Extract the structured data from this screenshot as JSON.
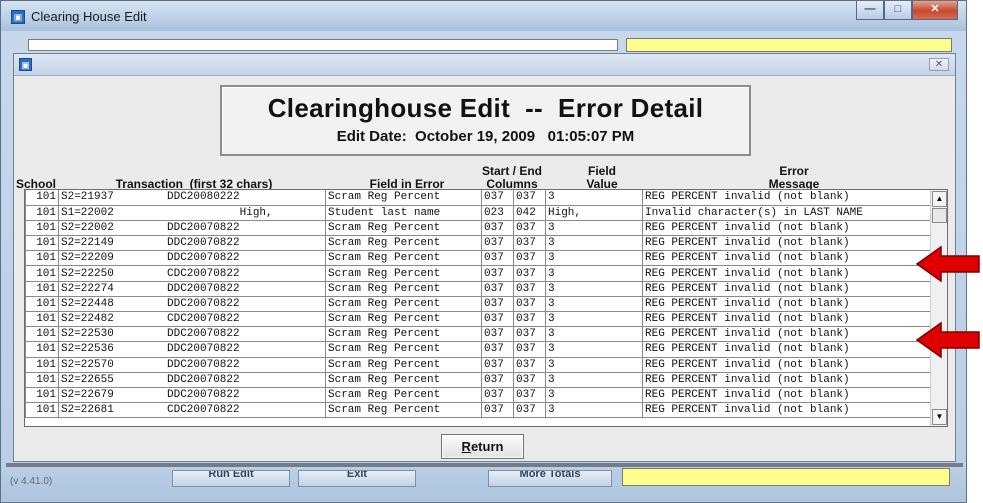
{
  "window": {
    "title": "Clearing House Edit",
    "icon": "app-icon",
    "minimize_icon": "minimize-icon",
    "maximize_icon": "maximize-icon",
    "close_icon": "close-icon"
  },
  "dialog": {
    "title": "Clearinghouse Edit  --  Error Detail",
    "subtitle": "Edit Date:  October 19, 2009   01:05:07 PM",
    "close_icon": "close-icon"
  },
  "columns": {
    "school": "School",
    "transaction": "Transaction  (first 32 chars)",
    "field_in_error": "Field in Error",
    "start_end_1": "Start / End",
    "start_end_2": "Columns",
    "field_value_1": "Field",
    "field_value_2": "Value",
    "error_message_1": "Error",
    "error_message_2": "Message"
  },
  "rows": [
    {
      "school": "101",
      "id": "S2=21937",
      "rest": "DDC20080222",
      "field": "Scram Reg Percent",
      "start": "037",
      "end": "037",
      "value": "3",
      "msg": "REG PERCENT invalid (not blank)"
    },
    {
      "school": "101",
      "id": "S1=22002",
      "rest": "           High,",
      "field": "Student last name",
      "start": "023",
      "end": "042",
      "value": "High,",
      "msg": "Invalid character(s) in LAST NAME"
    },
    {
      "school": "101",
      "id": "S2=22002",
      "rest": "DDC20070822",
      "field": "Scram Reg Percent",
      "start": "037",
      "end": "037",
      "value": "3",
      "msg": "REG PERCENT invalid (not blank)"
    },
    {
      "school": "101",
      "id": "S2=22149",
      "rest": "DDC20070822",
      "field": "Scram Reg Percent",
      "start": "037",
      "end": "037",
      "value": "3",
      "msg": "REG PERCENT invalid (not blank)"
    },
    {
      "school": "101",
      "id": "S2=22209",
      "rest": "DDC20070822",
      "field": "Scram Reg Percent",
      "start": "037",
      "end": "037",
      "value": "3",
      "msg": "REG PERCENT invalid (not blank)"
    },
    {
      "school": "101",
      "id": "S2=22250",
      "rest": "CDC20070822",
      "field": "Scram Reg Percent",
      "start": "037",
      "end": "037",
      "value": "3",
      "msg": "REG PERCENT invalid (not blank)"
    },
    {
      "school": "101",
      "id": "S2=22274",
      "rest": "DDC20070822",
      "field": "Scram Reg Percent",
      "start": "037",
      "end": "037",
      "value": "3",
      "msg": "REG PERCENT invalid (not blank)"
    },
    {
      "school": "101",
      "id": "S2=22448",
      "rest": "DDC20070822",
      "field": "Scram Reg Percent",
      "start": "037",
      "end": "037",
      "value": "3",
      "msg": "REG PERCENT invalid (not blank)"
    },
    {
      "school": "101",
      "id": "S2=22482",
      "rest": "CDC20070822",
      "field": "Scram Reg Percent",
      "start": "037",
      "end": "037",
      "value": "3",
      "msg": "REG PERCENT invalid (not blank)"
    },
    {
      "school": "101",
      "id": "S2=22530",
      "rest": "DDC20070822",
      "field": "Scram Reg Percent",
      "start": "037",
      "end": "037",
      "value": "3",
      "msg": "REG PERCENT invalid (not blank)"
    },
    {
      "school": "101",
      "id": "S2=22536",
      "rest": "DDC20070822",
      "field": "Scram Reg Percent",
      "start": "037",
      "end": "037",
      "value": "3",
      "msg": "REG PERCENT invalid (not blank)"
    },
    {
      "school": "101",
      "id": "S2=22570",
      "rest": "DDC20070822",
      "field": "Scram Reg Percent",
      "start": "037",
      "end": "037",
      "value": "3",
      "msg": "REG PERCENT invalid (not blank)"
    },
    {
      "school": "101",
      "id": "S2=22655",
      "rest": "DDC20070822",
      "field": "Scram Reg Percent",
      "start": "037",
      "end": "037",
      "value": "3",
      "msg": "REG PERCENT invalid (not blank)"
    },
    {
      "school": "101",
      "id": "S2=22679",
      "rest": "DDC20070822",
      "field": "Scram Reg Percent",
      "start": "037",
      "end": "037",
      "value": "3",
      "msg": "REG PERCENT invalid (not blank)"
    },
    {
      "school": "101",
      "id": "S2=22681",
      "rest": "CDC20070822",
      "field": "Scram Reg Percent",
      "start": "037",
      "end": "037",
      "value": "3",
      "msg": "REG PERCENT invalid (not blank)"
    }
  ],
  "scrollbar": {
    "up_icon": "scroll-up-icon",
    "down_icon": "scroll-down-icon"
  },
  "buttons": {
    "return_accel": "R",
    "return_rest": "eturn",
    "run_edit": "Run Edit",
    "exit": "Exit",
    "more_totals": "More Totals"
  },
  "bottom": {
    "version": "(v 4.41.0)"
  },
  "annotations": {
    "arrow_color": "#e00000",
    "arrow_icon": "red-arrow-icon"
  },
  "colors": {
    "highlight_field": "#fffe8c",
    "title_bar": "#c3d3e7"
  }
}
